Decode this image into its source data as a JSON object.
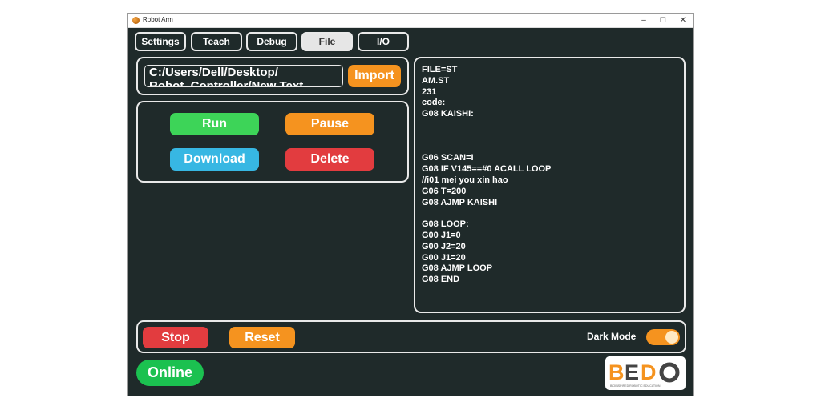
{
  "window": {
    "title": "Robot Arm",
    "minimize": "–",
    "maximize": "□",
    "close": "✕"
  },
  "tabs": [
    {
      "label": "Settings",
      "active": false
    },
    {
      "label": "Teach",
      "active": false
    },
    {
      "label": "Debug",
      "active": false
    },
    {
      "label": "File",
      "active": true
    },
    {
      "label": "I/O",
      "active": false
    }
  ],
  "file": {
    "path_value": "C:/Users/Dell/Desktop/\nRobot_Controller/New Text",
    "import_label": "Import"
  },
  "actions": {
    "run": "Run",
    "pause": "Pause",
    "download": "Download",
    "delete": "Delete"
  },
  "code_text": "FILE=ST\nAM.ST\n231\ncode:\nG08 KAISHI:\n\n\n\nG06 SCAN=I\nG08 IF V145==#0 ACALL LOOP\n//i01 mei you xin hao\nG06 T=200\nG08 AJMP KAISHI\n\nG08 LOOP:\nG00 J1=0\nG00 J2=20\nG00 J1=20\nG08 AJMP LOOP\nG08 END",
  "bottom": {
    "stop": "Stop",
    "reset": "Reset",
    "dark_mode_label": "Dark Mode",
    "dark_mode_on": true
  },
  "status": {
    "online": "Online"
  },
  "logo": {
    "text": "BEDO",
    "tagline": "BIOINSPIRED ROBOTIC EDUCATION"
  },
  "colors": {
    "background": "#1f2a2a",
    "orange": "#f5931f",
    "green": "#3dd458",
    "blue": "#37b7e3",
    "red": "#e23c3f",
    "online_green": "#1bc150"
  }
}
